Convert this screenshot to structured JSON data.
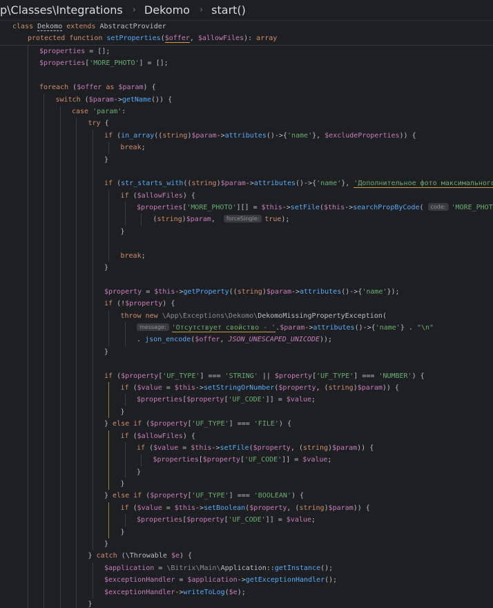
{
  "breadcrumb": {
    "path": "p\\Classes\\Integrations",
    "class": "Dekomo",
    "method": "start()"
  },
  "sticky": {
    "line1": {
      "k1": "class ",
      "cls": "Dekomo",
      "k2": " extends ",
      "parent": "AbstractProvider"
    },
    "line2": {
      "k1": "protected function ",
      "fn": "setProperties",
      "p1": "(",
      "v1": "$offer",
      ", ": ", ",
      "v2": "$allowFiles",
      "p2": "): ",
      "type": "array"
    }
  },
  "lines": [
    {
      "i": 2,
      "t": [
        [
          "var",
          "$properties"
        ],
        [
          "pl",
          " = [];"
        ]
      ]
    },
    {
      "i": 2,
      "t": [
        [
          "var",
          "$properties"
        ],
        [
          "pl",
          "["
        ],
        [
          "str",
          "'MORE_PHOTO'"
        ],
        [
          "pl",
          "] = [];"
        ]
      ]
    },
    {
      "i": 0,
      "t": []
    },
    {
      "i": 2,
      "t": [
        [
          "kw",
          "foreach"
        ],
        [
          "pl",
          " ("
        ],
        [
          "var",
          "$offer"
        ],
        [
          "kw",
          " as "
        ],
        [
          "var",
          "$param"
        ],
        [
          "pl",
          ") {"
        ]
      ]
    },
    {
      "i": 3,
      "t": [
        [
          "kw",
          "switch"
        ],
        [
          "pl",
          " ("
        ],
        [
          "var",
          "$param"
        ],
        [
          "pl",
          "->"
        ],
        [
          "fn",
          "getName"
        ],
        [
          "pl",
          "()) {"
        ]
      ]
    },
    {
      "i": 4,
      "t": [
        [
          "kw",
          "case "
        ],
        [
          "str",
          "'param'"
        ],
        [
          "pl",
          ":"
        ]
      ]
    },
    {
      "i": 5,
      "t": [
        [
          "kw",
          "try"
        ],
        [
          "pl",
          " {"
        ]
      ]
    },
    {
      "i": 6,
      "t": [
        [
          "kw",
          "if"
        ],
        [
          "pl",
          " ("
        ],
        [
          "fn",
          "in_array"
        ],
        [
          "pl",
          "(("
        ],
        [
          "kw",
          "string"
        ],
        [
          "pl",
          ")"
        ],
        [
          "var",
          "$param"
        ],
        [
          "pl",
          "->"
        ],
        [
          "fn",
          "attributes"
        ],
        [
          "pl",
          "()->{"
        ],
        [
          "str",
          "'name'"
        ],
        [
          "pl",
          "}, "
        ],
        [
          "var",
          "$excludeProperties"
        ],
        [
          "pl",
          ")) {"
        ]
      ]
    },
    {
      "i": 7,
      "t": [
        [
          "kw",
          "break"
        ],
        [
          "pl",
          ";"
        ]
      ]
    },
    {
      "i": 6,
      "t": [
        [
          "pl",
          "}"
        ]
      ]
    },
    {
      "i": 0,
      "t": []
    },
    {
      "i": 6,
      "t": [
        [
          "kw",
          "if"
        ],
        [
          "pl",
          " ("
        ],
        [
          "fn",
          "str_starts_with"
        ],
        [
          "pl",
          "(("
        ],
        [
          "kw",
          "string"
        ],
        [
          "pl",
          ")"
        ],
        [
          "var",
          "$param"
        ],
        [
          "pl",
          "->"
        ],
        [
          "fn",
          "attributes"
        ],
        [
          "pl",
          "()->{"
        ],
        [
          "str",
          "'name'"
        ],
        [
          "pl",
          "}, "
        ],
        [
          "strw",
          "'Дополнительное фото максимального ра"
        ]
      ]
    },
    {
      "i": 7,
      "t": [
        [
          "kw",
          "if"
        ],
        [
          "pl",
          " ("
        ],
        [
          "var",
          "$allowFiles"
        ],
        [
          "pl",
          ") {"
        ]
      ]
    },
    {
      "i": 8,
      "t": [
        [
          "var",
          "$properties"
        ],
        [
          "pl",
          "["
        ],
        [
          "str",
          "'MORE_PHOTO'"
        ],
        [
          "pl",
          "][] = "
        ],
        [
          "var",
          "$this"
        ],
        [
          "pl",
          "->"
        ],
        [
          "fn",
          "setFile"
        ],
        [
          "pl",
          "("
        ],
        [
          "var",
          "$this"
        ],
        [
          "pl",
          "->"
        ],
        [
          "fn",
          "searchPropByCode"
        ],
        [
          "pl",
          "( "
        ],
        [
          "hint",
          "code:"
        ],
        [
          "str",
          "'MORE_PHOTO'"
        ],
        [
          "pl",
          ")"
        ]
      ]
    },
    {
      "i": 9,
      "t": [
        [
          "pl",
          "("
        ],
        [
          "kw",
          "string"
        ],
        [
          "pl",
          ")"
        ],
        [
          "var",
          "$param"
        ],
        [
          "pl",
          ",  "
        ],
        [
          "hint",
          "forceSingle:"
        ],
        [
          "kw",
          "true"
        ],
        [
          "pl",
          ");"
        ]
      ]
    },
    {
      "i": 7,
      "t": [
        [
          "pl",
          "}"
        ]
      ]
    },
    {
      "i": 0,
      "t": []
    },
    {
      "i": 7,
      "t": [
        [
          "kw",
          "break"
        ],
        [
          "pl",
          ";"
        ]
      ]
    },
    {
      "i": 6,
      "t": [
        [
          "pl",
          "}"
        ]
      ]
    },
    {
      "i": 0,
      "t": []
    },
    {
      "i": 6,
      "t": [
        [
          "var",
          "$property"
        ],
        [
          "pl",
          " = "
        ],
        [
          "var",
          "$this"
        ],
        [
          "pl",
          "->"
        ],
        [
          "fn",
          "getProperty"
        ],
        [
          "pl",
          "(("
        ],
        [
          "kw",
          "string"
        ],
        [
          "pl",
          ")"
        ],
        [
          "var",
          "$param"
        ],
        [
          "pl",
          "->"
        ],
        [
          "fn",
          "attributes"
        ],
        [
          "pl",
          "()->{"
        ],
        [
          "str",
          "'name'"
        ],
        [
          "pl",
          "});"
        ]
      ]
    },
    {
      "i": 6,
      "t": [
        [
          "kw",
          "if"
        ],
        [
          "pl",
          " (!"
        ],
        [
          "var",
          "$property"
        ],
        [
          "pl",
          ") {"
        ]
      ]
    },
    {
      "i": 7,
      "t": [
        [
          "kw",
          "throw new "
        ],
        [
          "dim",
          "\\App\\Exceptions\\Dekomo\\"
        ],
        [
          "pl",
          "DekomoMissingPropertyException("
        ]
      ]
    },
    {
      "i": 8,
      "t": [
        [
          "hint",
          "message:"
        ],
        [
          "strw",
          "'Отсутствует свойство - '"
        ],
        [
          "pl",
          "."
        ],
        [
          "var",
          "$param"
        ],
        [
          "pl",
          "->"
        ],
        [
          "fn",
          "attributes"
        ],
        [
          "pl",
          "()->{"
        ],
        [
          "str",
          "'name'"
        ],
        [
          "pl",
          "} . "
        ],
        [
          "str",
          "\"\\n\""
        ]
      ]
    },
    {
      "i": 8,
      "t": [
        [
          "pl",
          ". "
        ],
        [
          "fn",
          "json_encode"
        ],
        [
          "pl",
          "("
        ],
        [
          "var",
          "$offer"
        ],
        [
          "pl",
          ", "
        ],
        [
          "const",
          "JSON_UNESCAPED_UNICODE"
        ],
        [
          "pl",
          "));"
        ]
      ]
    },
    {
      "i": 6,
      "t": [
        [
          "pl",
          "}"
        ]
      ]
    },
    {
      "i": 0,
      "t": []
    },
    {
      "i": 6,
      "t": [
        [
          "kw",
          "if"
        ],
        [
          "pl",
          " ("
        ],
        [
          "var",
          "$property"
        ],
        [
          "pl",
          "["
        ],
        [
          "str",
          "'UF_TYPE'"
        ],
        [
          "pl",
          "] === "
        ],
        [
          "str",
          "'STRING'"
        ],
        [
          "pl",
          " || "
        ],
        [
          "var",
          "$property"
        ],
        [
          "pl",
          "["
        ],
        [
          "str",
          "'UF_TYPE'"
        ],
        [
          "pl",
          "] === "
        ],
        [
          "str",
          "'NUMBER'"
        ],
        [
          "pl",
          ") {"
        ]
      ]
    },
    {
      "i": 7,
      "t": [
        [
          "kw",
          "if"
        ],
        [
          "pl",
          " ("
        ],
        [
          "var",
          "$value"
        ],
        [
          "pl",
          " = "
        ],
        [
          "var",
          "$this"
        ],
        [
          "pl",
          "->"
        ],
        [
          "fn",
          "setStringOrNumber"
        ],
        [
          "pl",
          "("
        ],
        [
          "var",
          "$property"
        ],
        [
          "pl",
          ", ("
        ],
        [
          "kw",
          "string"
        ],
        [
          "pl",
          ")"
        ],
        [
          "var",
          "$param"
        ],
        [
          "pl",
          ")) {"
        ]
      ]
    },
    {
      "i": 8,
      "t": [
        [
          "var",
          "$properties"
        ],
        [
          "pl",
          "["
        ],
        [
          "var",
          "$property"
        ],
        [
          "pl",
          "["
        ],
        [
          "str",
          "'UF_CODE'"
        ],
        [
          "pl",
          "]] = "
        ],
        [
          "var",
          "$value"
        ],
        [
          "pl",
          ";"
        ]
      ]
    },
    {
      "i": 7,
      "t": [
        [
          "pl",
          "}"
        ]
      ]
    },
    {
      "i": 6,
      "t": [
        [
          "pl",
          "} "
        ],
        [
          "kw",
          "else if"
        ],
        [
          "pl",
          " ("
        ],
        [
          "var",
          "$property"
        ],
        [
          "pl",
          "["
        ],
        [
          "str",
          "'UF_TYPE'"
        ],
        [
          "pl",
          "] === "
        ],
        [
          "str",
          "'FILE'"
        ],
        [
          "pl",
          ") {"
        ]
      ]
    },
    {
      "i": 7,
      "t": [
        [
          "kw",
          "if"
        ],
        [
          "pl",
          " ("
        ],
        [
          "var",
          "$allowFiles"
        ],
        [
          "pl",
          ") {"
        ]
      ]
    },
    {
      "i": 8,
      "t": [
        [
          "kw",
          "if"
        ],
        [
          "pl",
          " ("
        ],
        [
          "var",
          "$value"
        ],
        [
          "pl",
          " = "
        ],
        [
          "var",
          "$this"
        ],
        [
          "pl",
          "->"
        ],
        [
          "fn",
          "setFile"
        ],
        [
          "pl",
          "("
        ],
        [
          "var",
          "$property"
        ],
        [
          "pl",
          ", ("
        ],
        [
          "kw",
          "string"
        ],
        [
          "pl",
          ")"
        ],
        [
          "var",
          "$param"
        ],
        [
          "pl",
          ")) {"
        ]
      ]
    },
    {
      "i": 9,
      "t": [
        [
          "var",
          "$properties"
        ],
        [
          "pl",
          "["
        ],
        [
          "var",
          "$property"
        ],
        [
          "pl",
          "["
        ],
        [
          "str",
          "'UF_CODE'"
        ],
        [
          "pl",
          "]] = "
        ],
        [
          "var",
          "$value"
        ],
        [
          "pl",
          ";"
        ]
      ]
    },
    {
      "i": 8,
      "t": [
        [
          "pl",
          "}"
        ]
      ]
    },
    {
      "i": 7,
      "t": [
        [
          "pl",
          "}"
        ]
      ]
    },
    {
      "i": 6,
      "t": [
        [
          "pl",
          "} "
        ],
        [
          "kw",
          "else if"
        ],
        [
          "pl",
          " ("
        ],
        [
          "var",
          "$property"
        ],
        [
          "pl",
          "["
        ],
        [
          "str",
          "'UF_TYPE'"
        ],
        [
          "pl",
          "] === "
        ],
        [
          "str",
          "'BOOLEAN'"
        ],
        [
          "pl",
          ") {"
        ]
      ]
    },
    {
      "i": 7,
      "t": [
        [
          "kw",
          "if"
        ],
        [
          "pl",
          " ("
        ],
        [
          "var",
          "$value"
        ],
        [
          "pl",
          " = "
        ],
        [
          "var",
          "$this"
        ],
        [
          "pl",
          "->"
        ],
        [
          "fn",
          "setBoolean"
        ],
        [
          "pl",
          "("
        ],
        [
          "var",
          "$property"
        ],
        [
          "pl",
          ", ("
        ],
        [
          "kw",
          "string"
        ],
        [
          "pl",
          ")"
        ],
        [
          "var",
          "$param"
        ],
        [
          "pl",
          ")) {"
        ]
      ]
    },
    {
      "i": 8,
      "t": [
        [
          "var",
          "$properties"
        ],
        [
          "pl",
          "["
        ],
        [
          "var",
          "$property"
        ],
        [
          "pl",
          "["
        ],
        [
          "str",
          "'UF_CODE'"
        ],
        [
          "pl",
          "]] = "
        ],
        [
          "var",
          "$value"
        ],
        [
          "pl",
          ";"
        ]
      ]
    },
    {
      "i": 7,
      "t": [
        [
          "pl",
          "}"
        ]
      ]
    },
    {
      "i": 6,
      "t": [
        [
          "pl",
          "}"
        ]
      ]
    },
    {
      "i": 5,
      "t": [
        [
          "pl",
          "} "
        ],
        [
          "kw",
          "catch"
        ],
        [
          "pl",
          " (\\Throwable "
        ],
        [
          "var",
          "$e"
        ],
        [
          "pl",
          ") {"
        ]
      ]
    },
    {
      "i": 6,
      "t": [
        [
          "var",
          "$application"
        ],
        [
          "pl",
          " = "
        ],
        [
          "dim",
          "\\Bitrix\\Main\\"
        ],
        [
          "pl",
          "Application::"
        ],
        [
          "fn",
          "getInstance"
        ],
        [
          "pl",
          "();"
        ]
      ]
    },
    {
      "i": 6,
      "t": [
        [
          "var",
          "$exceptionHandler"
        ],
        [
          "pl",
          " = "
        ],
        [
          "var",
          "$application"
        ],
        [
          "pl",
          "->"
        ],
        [
          "fn",
          "getExceptionHandler"
        ],
        [
          "pl",
          "();"
        ]
      ]
    },
    {
      "i": 6,
      "t": [
        [
          "var",
          "$exceptionHandler"
        ],
        [
          "pl",
          "->"
        ],
        [
          "fn",
          "writeToLog"
        ],
        [
          "pl",
          "("
        ],
        [
          "var",
          "$e"
        ],
        [
          "pl",
          ");"
        ]
      ]
    },
    {
      "i": 5,
      "t": [
        [
          "pl",
          "}"
        ]
      ]
    }
  ]
}
